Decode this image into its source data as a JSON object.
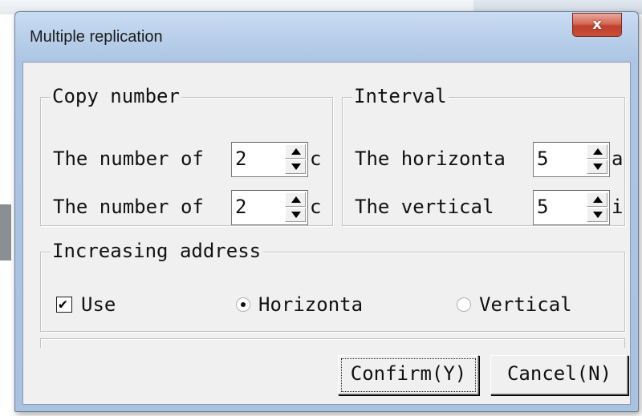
{
  "dialog": {
    "title": "Multiple replication",
    "close_glyph": "x"
  },
  "copy_number": {
    "legend": "Copy number",
    "row1_label": "The number of",
    "row1_value": "2",
    "row1_suffix": "c",
    "row2_label": "The number of",
    "row2_value": "2",
    "row2_suffix": "c"
  },
  "interval": {
    "legend": "Interval",
    "row1_label": "The horizonta",
    "row1_value": "5",
    "row1_suffix": "a",
    "row2_label": "The vertical",
    "row2_value": "5",
    "row2_suffix": "ic"
  },
  "increasing_address": {
    "legend": "Increasing address",
    "use_label": "Use",
    "use_checked": true,
    "check_glyph": "✔",
    "horizontal_label": "Horizonta",
    "horizontal_selected": true,
    "vertical_label": "Vertical",
    "vertical_selected": false
  },
  "buttons": {
    "confirm_label": "Confirm(Y)",
    "cancel_label": "Cancel(N)"
  }
}
